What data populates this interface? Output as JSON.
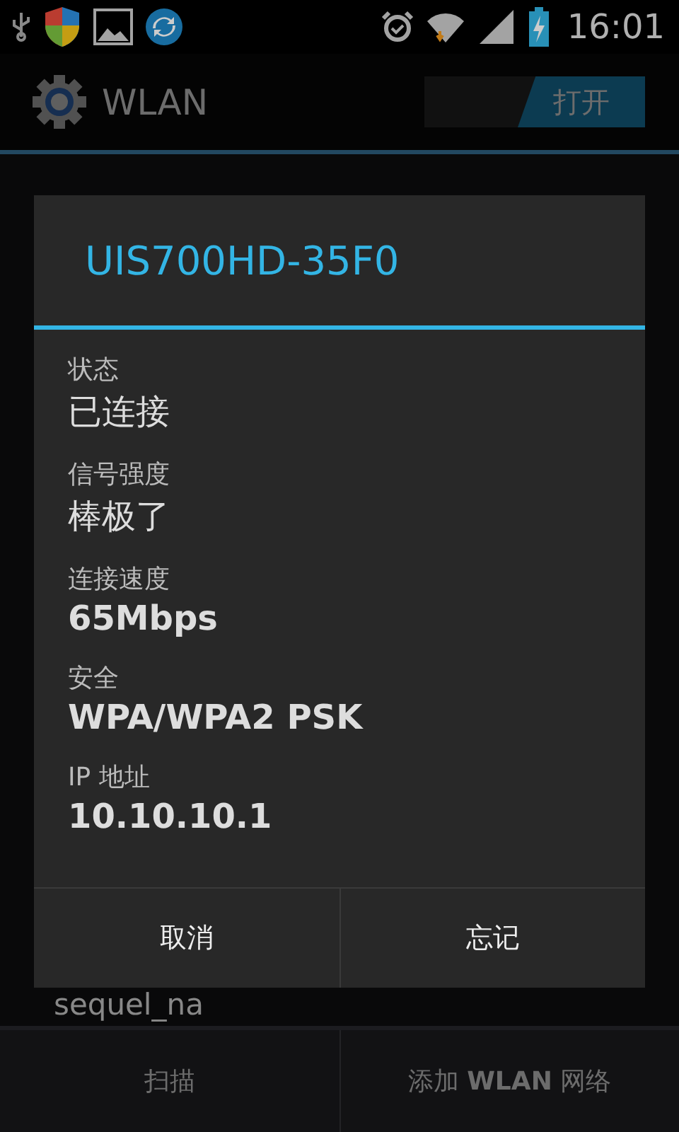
{
  "status_bar": {
    "time": "16:01"
  },
  "action_bar": {
    "title": "WLAN",
    "switch": {
      "label": "打开",
      "on": true
    }
  },
  "networks": [
    {
      "name": "sequel_na"
    }
  ],
  "dialog": {
    "title": "UIS700HD-35F0",
    "fields": [
      {
        "label": "状态",
        "value": "已连接",
        "bold": false
      },
      {
        "label": "信号强度",
        "value": "棒极了",
        "bold": false
      },
      {
        "label": "连接速度",
        "value": "65Mbps",
        "bold": true
      },
      {
        "label": "安全",
        "value": "WPA/WPA2 PSK",
        "bold": true
      },
      {
        "label": "IP 地址",
        "value": "10.10.10.1",
        "bold": true
      }
    ],
    "buttons": [
      "取消",
      "忘记"
    ]
  },
  "bottom_bar": {
    "buttons": [
      "扫描",
      "添加 **WLAN** 网络"
    ]
  }
}
